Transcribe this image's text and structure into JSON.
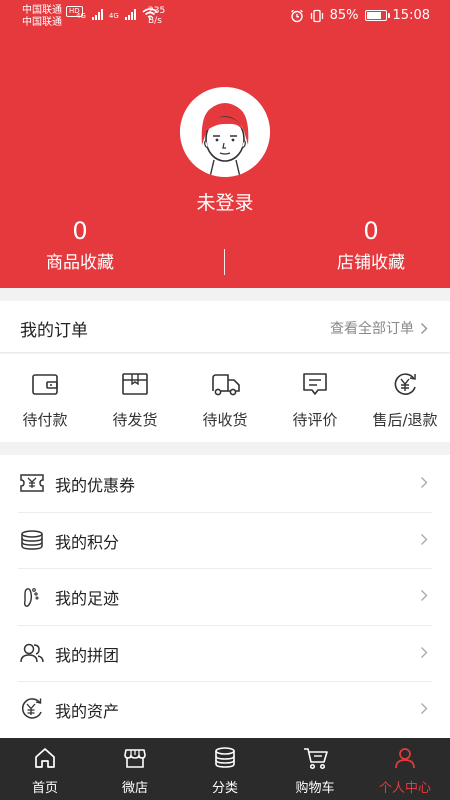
{
  "statusbar": {
    "carrier1": "中国联通",
    "hd": "HD",
    "carrier2": "中国联通",
    "net1": "4G",
    "net2": "4G",
    "speed_value": "235",
    "speed_unit": "B/s",
    "battery": "85%",
    "battery_level": 0.85,
    "time": "15:08"
  },
  "profile": {
    "username": "未登录"
  },
  "stats": {
    "goods_fav_count": "0",
    "goods_fav_label": "商品收藏",
    "shop_fav_count": "0",
    "shop_fav_label": "店铺收藏"
  },
  "orders": {
    "title": "我的订单",
    "view_all": "查看全部订单",
    "items": [
      {
        "label": "待付款",
        "icon": "wallet-icon"
      },
      {
        "label": "待发货",
        "icon": "box-icon"
      },
      {
        "label": "待收货",
        "icon": "truck-icon"
      },
      {
        "label": "待评价",
        "icon": "comment-icon"
      },
      {
        "label": "售后/退款",
        "icon": "refund-icon"
      }
    ]
  },
  "menu": {
    "items": [
      {
        "label": "我的优惠券",
        "icon": "coupon-icon"
      },
      {
        "label": "我的积分",
        "icon": "points-icon"
      },
      {
        "label": "我的足迹",
        "icon": "footprint-icon"
      },
      {
        "label": "我的拼团",
        "icon": "group-icon"
      },
      {
        "label": "我的资产",
        "icon": "assets-icon"
      }
    ]
  },
  "tabbar": {
    "items": [
      {
        "label": "首页",
        "icon": "home-icon"
      },
      {
        "label": "微店",
        "icon": "store-icon"
      },
      {
        "label": "分类",
        "icon": "category-icon"
      },
      {
        "label": "购物车",
        "icon": "cart-icon"
      },
      {
        "label": "个人中心",
        "icon": "person-icon"
      }
    ],
    "active_index": 4
  },
  "colors": {
    "brand": "#e5393e",
    "tabbar_bg": "#2b2b2b"
  }
}
